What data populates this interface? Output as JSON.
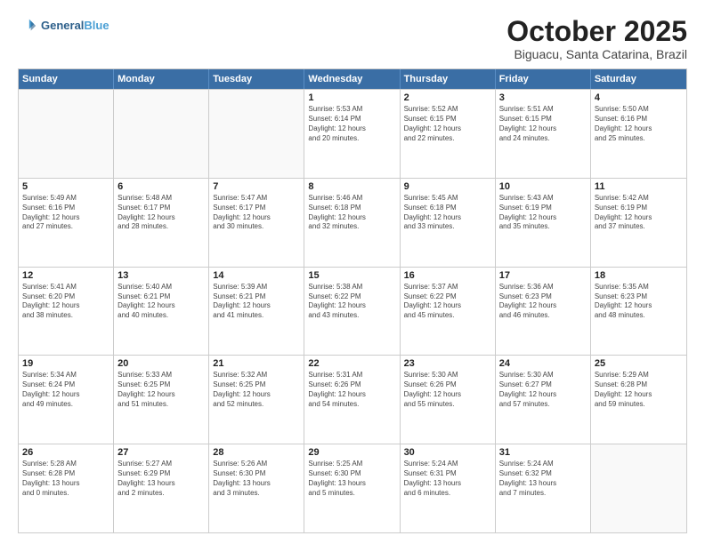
{
  "header": {
    "logo_line1": "General",
    "logo_line2": "Blue",
    "month": "October 2025",
    "location": "Biguacu, Santa Catarina, Brazil"
  },
  "weekdays": [
    "Sunday",
    "Monday",
    "Tuesday",
    "Wednesday",
    "Thursday",
    "Friday",
    "Saturday"
  ],
  "rows": [
    [
      {
        "day": "",
        "text": ""
      },
      {
        "day": "",
        "text": ""
      },
      {
        "day": "",
        "text": ""
      },
      {
        "day": "1",
        "text": "Sunrise: 5:53 AM\nSunset: 6:14 PM\nDaylight: 12 hours\nand 20 minutes."
      },
      {
        "day": "2",
        "text": "Sunrise: 5:52 AM\nSunset: 6:15 PM\nDaylight: 12 hours\nand 22 minutes."
      },
      {
        "day": "3",
        "text": "Sunrise: 5:51 AM\nSunset: 6:15 PM\nDaylight: 12 hours\nand 24 minutes."
      },
      {
        "day": "4",
        "text": "Sunrise: 5:50 AM\nSunset: 6:16 PM\nDaylight: 12 hours\nand 25 minutes."
      }
    ],
    [
      {
        "day": "5",
        "text": "Sunrise: 5:49 AM\nSunset: 6:16 PM\nDaylight: 12 hours\nand 27 minutes."
      },
      {
        "day": "6",
        "text": "Sunrise: 5:48 AM\nSunset: 6:17 PM\nDaylight: 12 hours\nand 28 minutes."
      },
      {
        "day": "7",
        "text": "Sunrise: 5:47 AM\nSunset: 6:17 PM\nDaylight: 12 hours\nand 30 minutes."
      },
      {
        "day": "8",
        "text": "Sunrise: 5:46 AM\nSunset: 6:18 PM\nDaylight: 12 hours\nand 32 minutes."
      },
      {
        "day": "9",
        "text": "Sunrise: 5:45 AM\nSunset: 6:18 PM\nDaylight: 12 hours\nand 33 minutes."
      },
      {
        "day": "10",
        "text": "Sunrise: 5:43 AM\nSunset: 6:19 PM\nDaylight: 12 hours\nand 35 minutes."
      },
      {
        "day": "11",
        "text": "Sunrise: 5:42 AM\nSunset: 6:19 PM\nDaylight: 12 hours\nand 37 minutes."
      }
    ],
    [
      {
        "day": "12",
        "text": "Sunrise: 5:41 AM\nSunset: 6:20 PM\nDaylight: 12 hours\nand 38 minutes."
      },
      {
        "day": "13",
        "text": "Sunrise: 5:40 AM\nSunset: 6:21 PM\nDaylight: 12 hours\nand 40 minutes."
      },
      {
        "day": "14",
        "text": "Sunrise: 5:39 AM\nSunset: 6:21 PM\nDaylight: 12 hours\nand 41 minutes."
      },
      {
        "day": "15",
        "text": "Sunrise: 5:38 AM\nSunset: 6:22 PM\nDaylight: 12 hours\nand 43 minutes."
      },
      {
        "day": "16",
        "text": "Sunrise: 5:37 AM\nSunset: 6:22 PM\nDaylight: 12 hours\nand 45 minutes."
      },
      {
        "day": "17",
        "text": "Sunrise: 5:36 AM\nSunset: 6:23 PM\nDaylight: 12 hours\nand 46 minutes."
      },
      {
        "day": "18",
        "text": "Sunrise: 5:35 AM\nSunset: 6:23 PM\nDaylight: 12 hours\nand 48 minutes."
      }
    ],
    [
      {
        "day": "19",
        "text": "Sunrise: 5:34 AM\nSunset: 6:24 PM\nDaylight: 12 hours\nand 49 minutes."
      },
      {
        "day": "20",
        "text": "Sunrise: 5:33 AM\nSunset: 6:25 PM\nDaylight: 12 hours\nand 51 minutes."
      },
      {
        "day": "21",
        "text": "Sunrise: 5:32 AM\nSunset: 6:25 PM\nDaylight: 12 hours\nand 52 minutes."
      },
      {
        "day": "22",
        "text": "Sunrise: 5:31 AM\nSunset: 6:26 PM\nDaylight: 12 hours\nand 54 minutes."
      },
      {
        "day": "23",
        "text": "Sunrise: 5:30 AM\nSunset: 6:26 PM\nDaylight: 12 hours\nand 55 minutes."
      },
      {
        "day": "24",
        "text": "Sunrise: 5:30 AM\nSunset: 6:27 PM\nDaylight: 12 hours\nand 57 minutes."
      },
      {
        "day": "25",
        "text": "Sunrise: 5:29 AM\nSunset: 6:28 PM\nDaylight: 12 hours\nand 59 minutes."
      }
    ],
    [
      {
        "day": "26",
        "text": "Sunrise: 5:28 AM\nSunset: 6:28 PM\nDaylight: 13 hours\nand 0 minutes."
      },
      {
        "day": "27",
        "text": "Sunrise: 5:27 AM\nSunset: 6:29 PM\nDaylight: 13 hours\nand 2 minutes."
      },
      {
        "day": "28",
        "text": "Sunrise: 5:26 AM\nSunset: 6:30 PM\nDaylight: 13 hours\nand 3 minutes."
      },
      {
        "day": "29",
        "text": "Sunrise: 5:25 AM\nSunset: 6:30 PM\nDaylight: 13 hours\nand 5 minutes."
      },
      {
        "day": "30",
        "text": "Sunrise: 5:24 AM\nSunset: 6:31 PM\nDaylight: 13 hours\nand 6 minutes."
      },
      {
        "day": "31",
        "text": "Sunrise: 5:24 AM\nSunset: 6:32 PM\nDaylight: 13 hours\nand 7 minutes."
      },
      {
        "day": "",
        "text": ""
      }
    ]
  ]
}
